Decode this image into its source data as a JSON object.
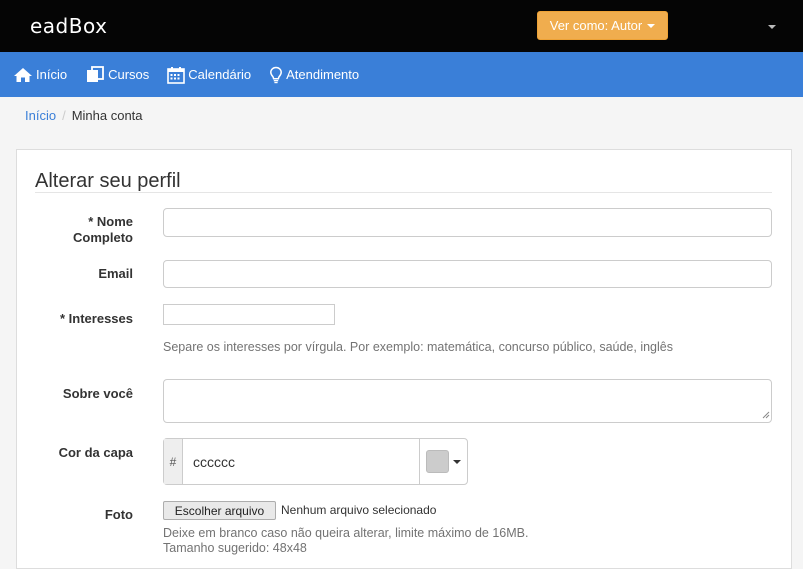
{
  "header": {
    "logo": "eadBox",
    "view_as_label": "Ver como: Autor"
  },
  "nav": {
    "items": [
      {
        "label": "Início",
        "icon": "home-icon"
      },
      {
        "label": "Cursos",
        "icon": "copy-icon"
      },
      {
        "label": "Calendário",
        "icon": "calendar-icon"
      },
      {
        "label": "Atendimento",
        "icon": "lightbulb-icon"
      }
    ]
  },
  "breadcrumb": {
    "home": "Início",
    "separator": "/",
    "current": "Minha conta"
  },
  "form": {
    "title": "Alterar seu perfil",
    "name_label": "* Nome Completo",
    "name_value": "",
    "email_label": "Email",
    "email_value": "",
    "interests_label": "* Interesses",
    "interests_value": "",
    "interests_help": "Separe os interesses por vírgula. Por exemplo: matemática, concurso público, saúde, inglês",
    "about_label": "Sobre você",
    "about_value": "",
    "cover_label": "Cor da capa",
    "cover_prefix": "#",
    "cover_value": "cccccc",
    "photo_label": "Foto",
    "photo_button": "Escolher arquivo",
    "photo_status": "Nenhum arquivo selecionado",
    "photo_help_1": "Deixe em branco caso não queira alterar, limite máximo de 16MB.",
    "photo_help_2": "Tamanho sugerido: 48x48"
  },
  "colors": {
    "topbar": "#050505",
    "navbar": "#3a7fd8",
    "accent_button": "#f0ad4e",
    "swatch": "#cccccc"
  }
}
